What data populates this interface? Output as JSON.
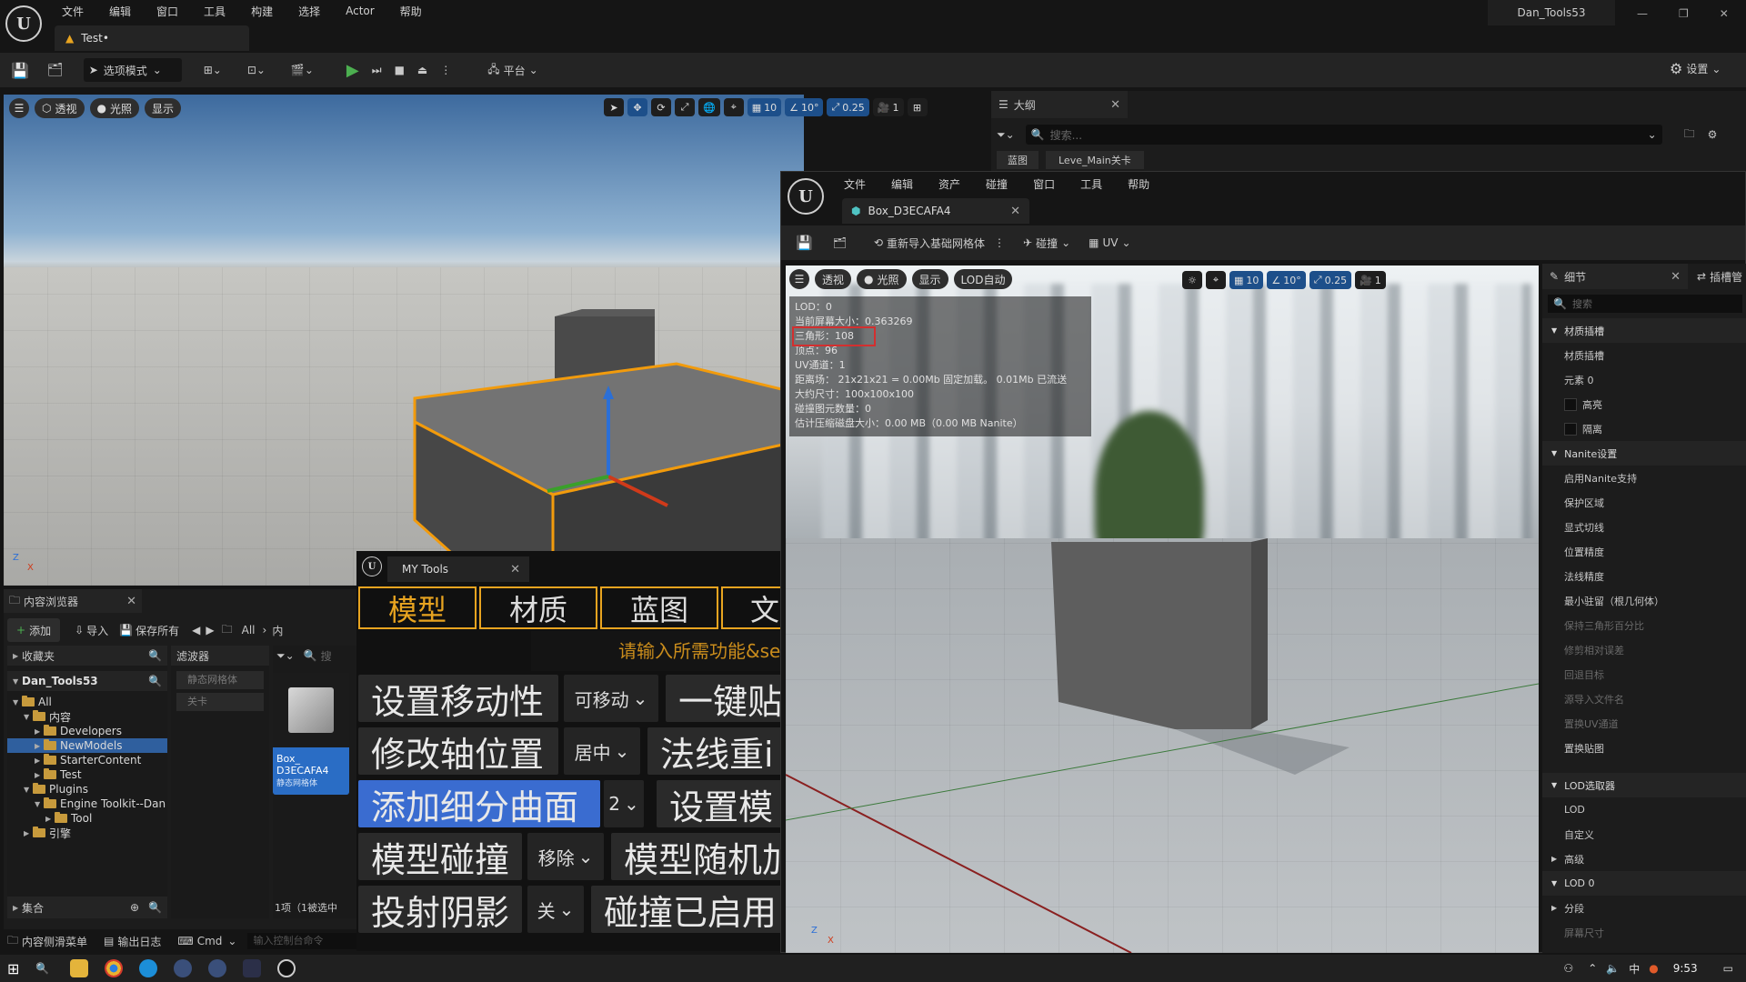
{
  "main_menu": [
    "文件",
    "编辑",
    "窗口",
    "工具",
    "构建",
    "选择",
    "Actor",
    "帮助"
  ],
  "project_name": "Dan_Tools53",
  "level_tab": "Test•",
  "toolbar": {
    "mode": "选项模式",
    "platform": "平台",
    "settings": "设置"
  },
  "viewport": {
    "perspective": "透视",
    "lit": "光照",
    "show": "显示",
    "grid": "10",
    "angle": "10°",
    "scale": "0.25",
    "camera": "1"
  },
  "outliner": {
    "title": "大纲",
    "search_placeholder": "搜索...",
    "chips": [
      "蓝图",
      "Leve_Main关卡"
    ]
  },
  "content_browser": {
    "title": "内容浏览器",
    "add": "添加",
    "import": "导入",
    "save_all": "保存所有",
    "path": [
      "All",
      "内"
    ],
    "favorites": "收藏夹",
    "project": "Dan_Tools53",
    "filters": "滤波器",
    "filter_items": [
      "静态网格体",
      "关卡"
    ],
    "search_placeholder": "搜",
    "collections": "集合",
    "status": "1项（1被选中",
    "tree": [
      {
        "label": "All",
        "depth": 0
      },
      {
        "label": "内容",
        "depth": 1
      },
      {
        "label": "Developers",
        "depth": 2
      },
      {
        "label": "NewModels",
        "depth": 2,
        "selected": true
      },
      {
        "label": "StarterContent",
        "depth": 2
      },
      {
        "label": "Test",
        "depth": 2
      },
      {
        "label": "Plugins",
        "depth": 1
      },
      {
        "label": "Engine Toolkit--Dan",
        "depth": 2
      },
      {
        "label": "Tool",
        "depth": 3
      },
      {
        "label": "引擎",
        "depth": 1
      }
    ],
    "asset": {
      "name1": "Box_",
      "name2": "D3ECAFA4",
      "type": "静态网格体"
    }
  },
  "bottom_bar": {
    "drawer": "内容侧滑菜单",
    "output": "输出日志",
    "cmd": "Cmd",
    "console_placeholder": "输入控制台命令"
  },
  "my_tools": {
    "title": "MY Tools",
    "tabs": [
      "模型",
      "材质",
      "蓝图",
      "文"
    ],
    "hint": "请输入所需功能&se",
    "rows": [
      {
        "btn": "设置移动性",
        "dd": "可移动",
        "btn2": "一键贴"
      },
      {
        "btn": "修改轴位置",
        "dd": "居中",
        "btn2": "法线重i"
      },
      {
        "btn": "添加细分曲面",
        "dd": "2",
        "btn2": "设置模"
      },
      {
        "btn": "模型碰撞",
        "dd": "移除",
        "btn2": "模型随机加"
      },
      {
        "btn": "投射阴影",
        "dd": "关",
        "btn2": "碰撞已启用"
      }
    ]
  },
  "mesh_editor": {
    "menu": [
      "文件",
      "编辑",
      "资产",
      "碰撞",
      "窗口",
      "工具",
      "帮助"
    ],
    "tab": "Box_D3ECAFA4",
    "reimport": "重新导入基础网格体",
    "collision": "碰撞",
    "uv": "UV",
    "vp": {
      "perspective": "透视",
      "lit": "光照",
      "show": "显示",
      "lod": "LOD自动",
      "grid": "10",
      "angle": "10°",
      "scale": "0.25",
      "camera": "1"
    },
    "stats": [
      "LOD：0",
      "当前屏幕大小：0.363269",
      "三角形：108",
      "顶点：96",
      "UV通道：1",
      "距离场： 21x21x21 = 0.00Mb 固定加载。 0.01Mb 已流送",
      "大约尺寸：100x100x100",
      "碰撞图元数量：0",
      "估计压缩磁盘大小：0.00 MB（0.00 MB Nanite）"
    ]
  },
  "details": {
    "title": "细节",
    "tab2": "插槽管",
    "search_placeholder": "搜索",
    "rows": [
      {
        "t": "head",
        "label": "材质插槽"
      },
      {
        "t": "row",
        "label": "材质插槽"
      },
      {
        "t": "row",
        "label": "元素 0"
      },
      {
        "t": "check",
        "label": "高亮"
      },
      {
        "t": "check",
        "label": "隔离"
      },
      {
        "t": "head",
        "label": "Nanite设置"
      },
      {
        "t": "row",
        "label": "启用Nanite支持"
      },
      {
        "t": "row",
        "label": "保护区域"
      },
      {
        "t": "row",
        "label": "显式切线"
      },
      {
        "t": "row",
        "label": "位置精度"
      },
      {
        "t": "row",
        "label": "法线精度"
      },
      {
        "t": "row",
        "label": "最小驻留（根几何体）"
      },
      {
        "t": "dim",
        "label": "保持三角形百分比"
      },
      {
        "t": "dim",
        "label": "修剪相对误差"
      },
      {
        "t": "dim",
        "label": "回退目标"
      },
      {
        "t": "dim",
        "label": "源导入文件名"
      },
      {
        "t": "dim",
        "label": "置换UV通道"
      },
      {
        "t": "row",
        "label": "置换贴图"
      },
      {
        "t": "gap",
        "label": ""
      },
      {
        "t": "head",
        "label": "LOD选取器"
      },
      {
        "t": "row",
        "label": "LOD"
      },
      {
        "t": "row",
        "label": "自定义"
      },
      {
        "t": "sub",
        "label": "高级"
      },
      {
        "t": "head",
        "label": "LOD 0"
      },
      {
        "t": "sub",
        "label": "分段"
      },
      {
        "t": "dim",
        "label": "屏幕尺寸"
      }
    ]
  },
  "taskbar": {
    "time": "9:53"
  },
  "colors": {
    "accent": "#e8a420",
    "blue": "#1d4f8a",
    "highlight": "#d32f2f"
  }
}
